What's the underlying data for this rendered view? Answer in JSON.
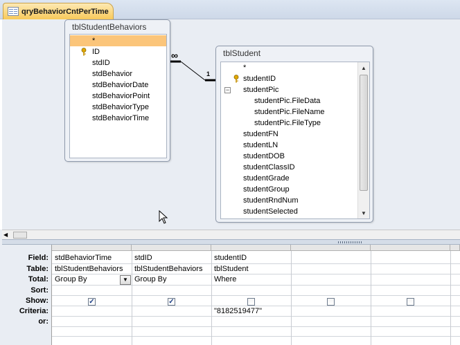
{
  "tab": {
    "label": "qryBehaviorCntPerTime",
    "icon": "query-icon"
  },
  "tables": {
    "behaviors": {
      "title": "tblStudentBehaviors",
      "fields": [
        "*",
        "ID",
        "stdID",
        "stdBehavior",
        "stdBehaviorDate",
        "stdBehaviorPoint",
        "stdBehaviorType",
        "stdBehaviorTime"
      ]
    },
    "student": {
      "title": "tblStudent",
      "fields": [
        "*",
        "studentID",
        "studentPic",
        "studentPic.FileData",
        "studentPic.FileName",
        "studentPic.FileType",
        "studentFN",
        "studentLN",
        "studentDOB",
        "studentClassID",
        "studentGrade",
        "studentGroup",
        "studentRndNum",
        "studentSelected"
      ]
    }
  },
  "relationship": {
    "many_symbol": "∞",
    "one_symbol": "1"
  },
  "grid": {
    "row_labels": [
      "Field:",
      "Table:",
      "Total:",
      "Sort:",
      "Show:",
      "Criteria:",
      "or:"
    ],
    "columns": [
      {
        "field": "stdBehaviorTime",
        "table": "tblStudentBehaviors",
        "total": "Group By",
        "sort": "",
        "show": true,
        "criteria": ""
      },
      {
        "field": "stdID",
        "table": "tblStudentBehaviors",
        "total": "Group By",
        "sort": "",
        "show": true,
        "criteria": ""
      },
      {
        "field": "studentID",
        "table": "tblStudent",
        "total": "Where",
        "sort": "",
        "show": false,
        "criteria": "\"8182519477\""
      },
      {
        "field": "",
        "table": "",
        "total": "",
        "sort": "",
        "show": false,
        "criteria": ""
      },
      {
        "field": "",
        "table": "",
        "total": "",
        "sort": "",
        "show": false,
        "criteria": ""
      }
    ]
  },
  "colors": {
    "tab": "#f8c95a",
    "selected_field": "#fbc57a",
    "surface": "#e9edf3"
  }
}
